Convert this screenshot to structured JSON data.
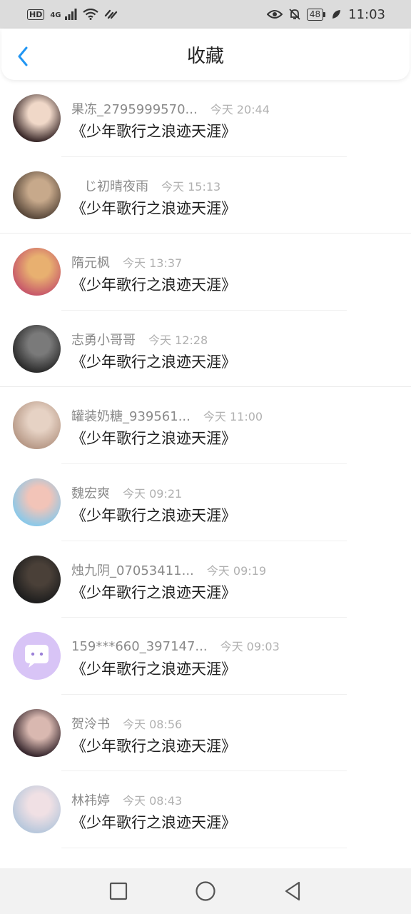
{
  "status_bar": {
    "hd": "HD",
    "network": "4G",
    "battery": "48",
    "time": "11:03"
  },
  "header": {
    "title": "收藏",
    "back_icon": "chevron-left-icon",
    "accent_color": "#2196f3"
  },
  "favorites": [
    {
      "username": "果冻_2795999570...",
      "time": "今天 20:44",
      "content": "《少年歌行之浪迹天涯》",
      "avatar_colors": [
        "#3b2a2a",
        "#f0d8c8"
      ]
    },
    {
      "username": "　じ初晴夜雨",
      "time": "今天 15:13",
      "content": "《少年歌行之浪迹天涯》",
      "avatar_colors": [
        "#5b4a3c",
        "#c7a98b"
      ]
    },
    {
      "username": "隋元枫",
      "time": "今天 13:37",
      "content": "《少年歌行之浪迹天涯》",
      "avatar_colors": [
        "#c85a6a",
        "#e8b070"
      ]
    },
    {
      "username": "志勇小哥哥",
      "time": "今天 12:28",
      "content": "《少年歌行之浪迹天涯》",
      "avatar_colors": [
        "#2c2c2c",
        "#7a7a7a"
      ]
    },
    {
      "username": "罐装奶糖_939561...",
      "time": "今天 11:00",
      "content": "《少年歌行之浪迹天涯》",
      "avatar_colors": [
        "#b89a88",
        "#e6d2c4"
      ]
    },
    {
      "username": "魏宏爽",
      "time": "今天 09:21",
      "content": "《少年歌行之浪迹天涯》",
      "avatar_colors": [
        "#8cc8e8",
        "#f2c4b8"
      ]
    },
    {
      "username": "烛九阴_07053411...",
      "time": "今天 09:19",
      "content": "《少年歌行之浪迹天涯》",
      "avatar_colors": [
        "#1e1e1e",
        "#4a4038"
      ]
    },
    {
      "username": "159***660_397147...",
      "time": "今天 09:03",
      "content": "《少年歌行之浪迹天涯》",
      "avatar_colors": [
        "#c9b0f0",
        "#d8c4f6"
      ]
    },
    {
      "username": "贺泠书",
      "time": "今天 08:56",
      "content": "《少年歌行之浪迹天涯》",
      "avatar_colors": [
        "#3a2a30",
        "#d9b8b0"
      ]
    },
    {
      "username": "林祎婷",
      "time": "今天 08:43",
      "content": "《少年歌行之浪迹天涯》",
      "avatar_colors": [
        "#b8c8dc",
        "#f0e0e4"
      ]
    }
  ],
  "nav_bar": {
    "recent_icon": "square-icon",
    "home_icon": "circle-icon",
    "back_icon": "triangle-back-icon"
  }
}
